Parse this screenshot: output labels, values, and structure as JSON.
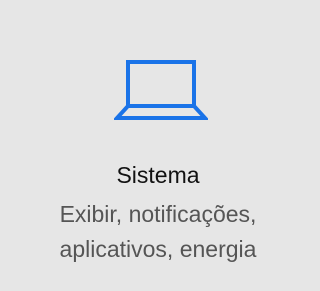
{
  "tile": {
    "icon": "laptop-icon",
    "accent_color": "#1a73e8",
    "title": "Sistema",
    "description_lines": [
      "Exibir, notificações,",
      "aplicativos, energia"
    ]
  }
}
